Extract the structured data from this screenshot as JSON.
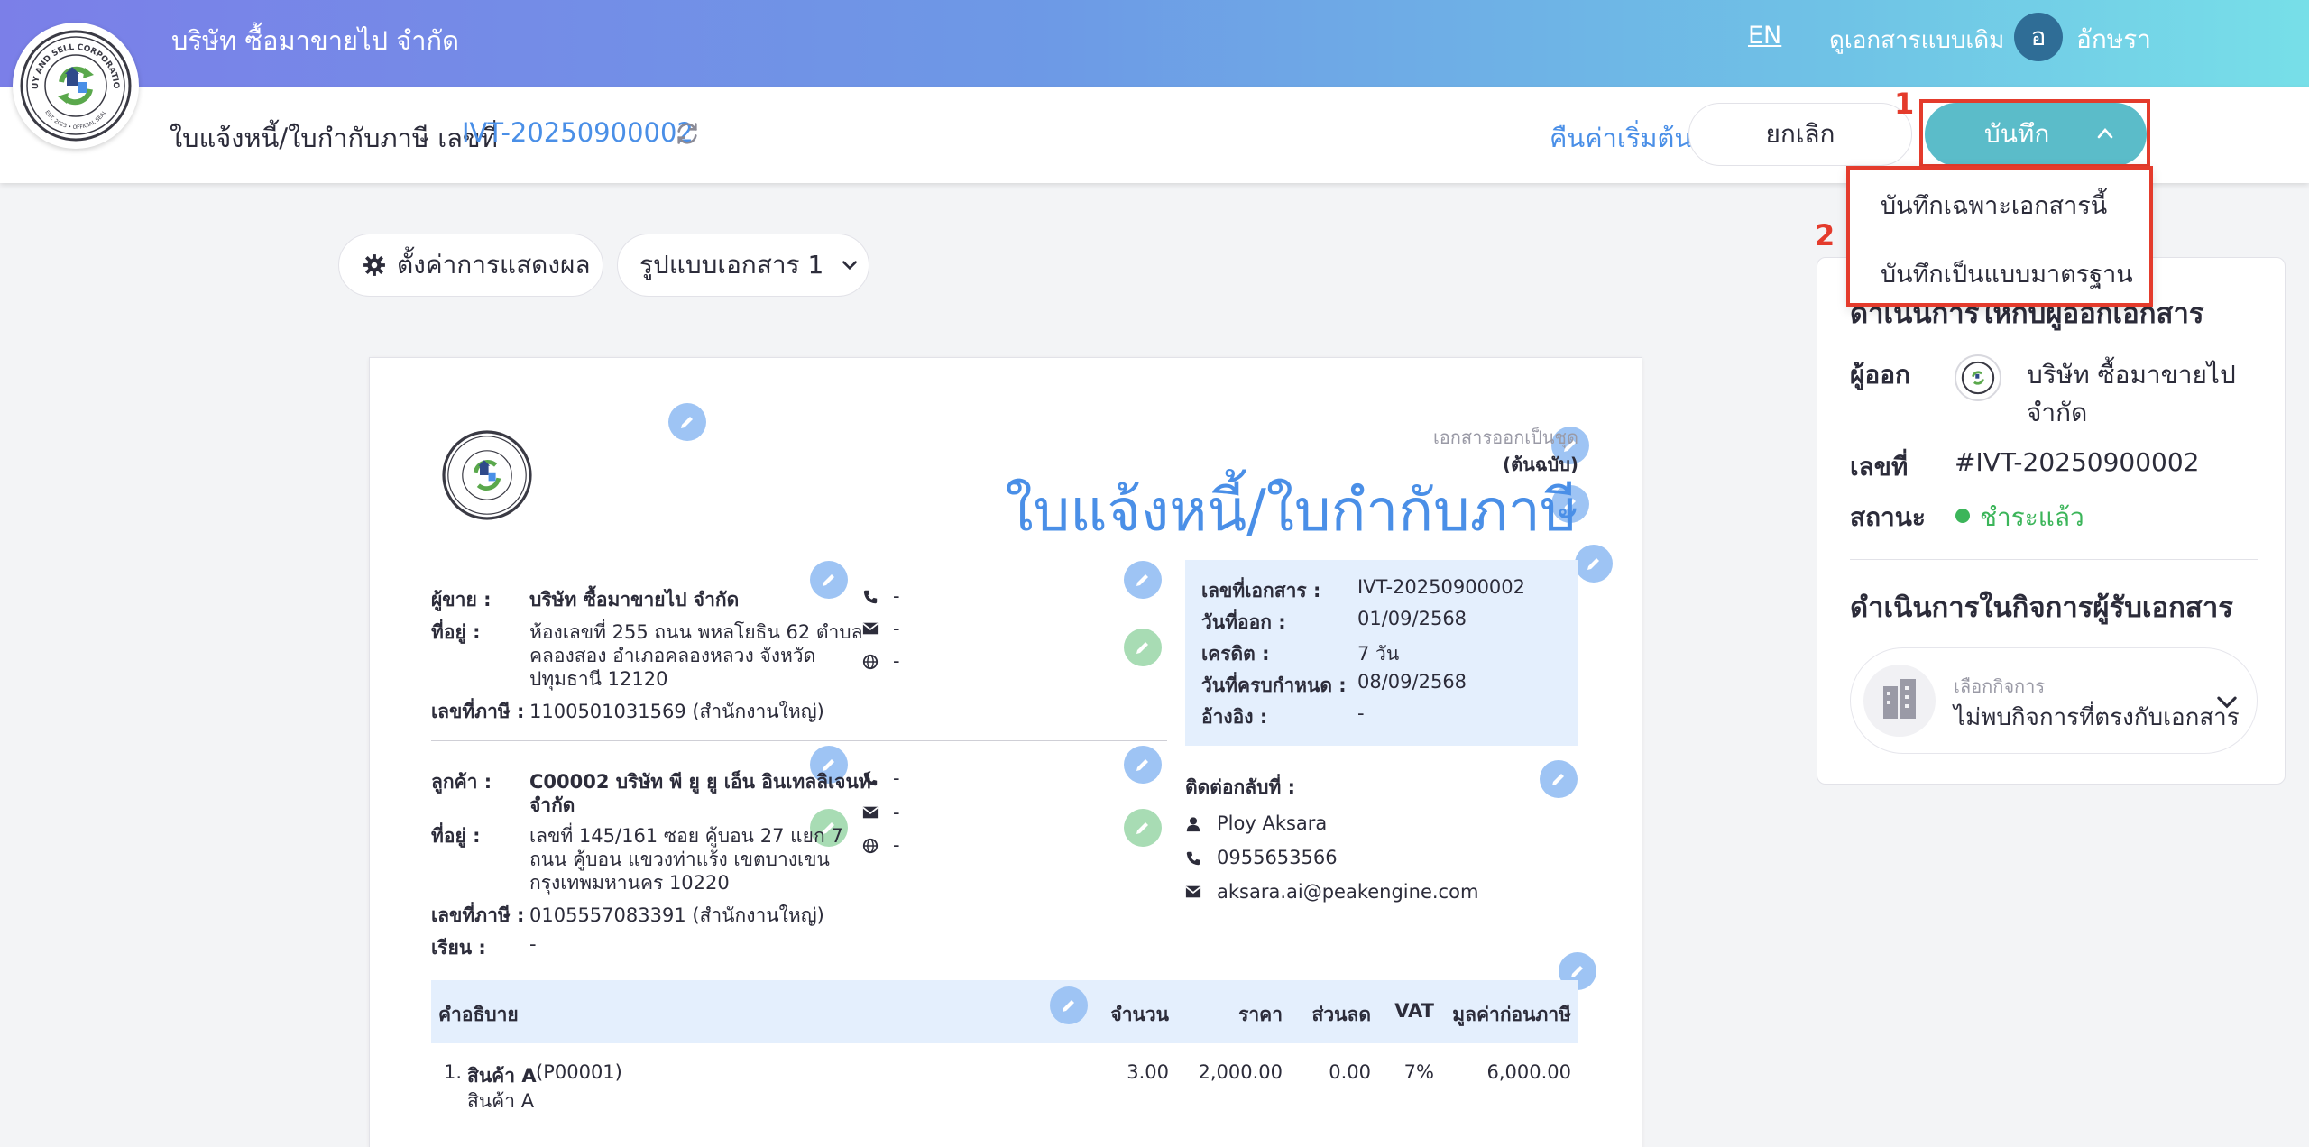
{
  "topbar": {
    "company": "บริษัท ซื้อมาขายไป จำกัด",
    "lang": "EN",
    "old_view": "ดูเอกสารแบบเดิม",
    "avatar_initial": "อ",
    "username": "อักษรา"
  },
  "logo": {
    "text_top": "BUY AND SELL CORPORATION",
    "text_bottom": "EST. 2023 • OFFICIAL SEAL",
    "est": "EST. 2023"
  },
  "subheader": {
    "doc_label": "ใบแจ้งหนี้/ใบกำกับภาษี เลขที่",
    "doc_number": "IVT-20250900002",
    "reset": "คืนค่าเริ่มต้น",
    "cancel": "ยกเลิก",
    "save": "บันทึก"
  },
  "annotations": {
    "one": "1",
    "two": "2"
  },
  "save_menu": {
    "items": [
      "บันทึกเฉพาะเอกสารนี้",
      "บันทึกเป็นแบบมาตรฐาน"
    ]
  },
  "toolbar": {
    "display_settings": "ตั้งค่าการแสดงผล",
    "template": "รูปแบบเอกสาร 1"
  },
  "document": {
    "issued_set": "เอกสารออกเป็นชุด",
    "original": "(ต้นฉบับ)",
    "title": "ใบแจ้งหนี้/ใบกำกับภาษี",
    "seller": {
      "label": "ผู้ขาย :",
      "name": "บริษัท ซื้อมาขายไป จำกัด",
      "address_label": "ที่อยู่ :",
      "address": [
        "ห้องเลขที่ 255 ถนน พหลโยธิน 62 ตำบล",
        "คลองสอง อำเภอคลองหลวง จังหวัด",
        "ปทุมธานี 12120"
      ],
      "tax_label": "เลขที่ภาษี :",
      "tax": "1100501031569 (สำนักงานใหญ่)",
      "phone": "-",
      "email": "-",
      "web": "-"
    },
    "customer": {
      "label": "ลูกค้า :",
      "name": [
        "C00002 บริษัท พี ยู ยู เอ็น อินเทลลิเจนท์",
        "จำกัด"
      ],
      "address_label": "ที่อยู่ :",
      "address": [
        "เลขที่ 145/161     ซอย คู้บอน 27 แยก 7",
        "ถนน คู้บอน  แขวงท่าแร้ง เขตบางเขน",
        "กรุงเทพมหานคร 10220"
      ],
      "tax_label": "เลขที่ภาษี :",
      "tax": "0105557083391 (สำนักงานใหญ่)",
      "attn_label": "เรียน :",
      "attn": "-",
      "phone": "-",
      "email": "-",
      "web": "-"
    },
    "info": [
      {
        "label": "เลขที่เอกสาร :",
        "value": "IVT-20250900002"
      },
      {
        "label": "วันที่ออก :",
        "value": "01/09/2568"
      },
      {
        "label": "เครดิต :",
        "value": "7 วัน"
      },
      {
        "label": "วันที่ครบกำหนด :",
        "value": "08/09/2568"
      },
      {
        "label": "อ้างอิง :",
        "value": "-"
      }
    ],
    "contact": {
      "label": "ติดต่อกลับที่ :",
      "name": "Ploy Aksara",
      "phone": "0955653566",
      "email": "aksara.ai@peakengine.com"
    },
    "table": {
      "headers": [
        "คำอธิบาย",
        "จำนวน",
        "ราคา",
        "ส่วนลด",
        "VAT",
        "มูลค่าก่อนภาษี"
      ],
      "rows": [
        {
          "no": "1.",
          "name": "สินค้า A",
          "code": "(P00001)",
          "desc": "สินค้า A",
          "qty": "3.00",
          "price": "2,000.00",
          "discount": "0.00",
          "vat": "7%",
          "amount": "6,000.00"
        }
      ]
    }
  },
  "right_panel": {
    "section1": "ดำเนินการให้กับผู้ออกเอกสาร",
    "issuer_label": "ผู้ออก",
    "issuer_name": [
      "บริษัท ซื้อมาขายไป",
      "จำกัด"
    ],
    "number_label": "เลขที่",
    "number": "#IVT-20250900002",
    "status_label": "สถานะ",
    "status": "ชำระแล้ว",
    "section2": "ดำเนินการในกิจการผู้รับเอกสาร",
    "select_label": "เลือกกิจการ",
    "select_value": "ไม่พบกิจการที่ตรงกับเอกสาร"
  },
  "colors": {
    "accent": "#4a8fe7",
    "save": "#5bbcc9",
    "highlight": "#e43b2c",
    "status": "#3cb55a"
  }
}
